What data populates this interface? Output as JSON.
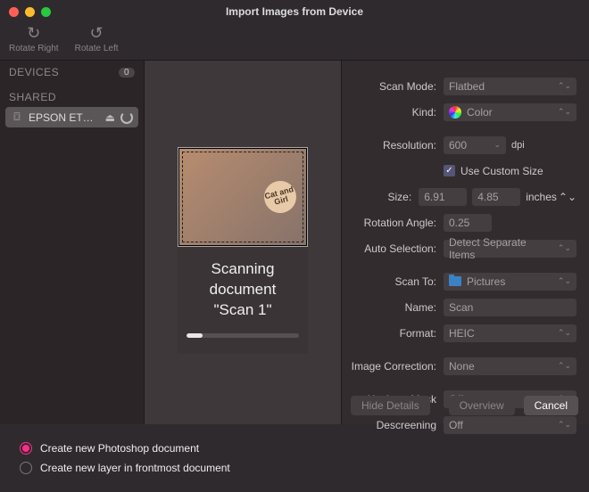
{
  "window": {
    "title": "Import Images from Device"
  },
  "toolbar": {
    "rotate_right": "Rotate Right",
    "rotate_left": "Rotate Left"
  },
  "sidebar": {
    "devices_header": "DEVICES",
    "devices_count": "0",
    "shared_header": "SHARED",
    "device_name": "EPSON ET…"
  },
  "scan": {
    "line1": "Scanning",
    "line2": "document",
    "line3": "\"Scan 1\"",
    "badge": "Cat and Girl"
  },
  "settings": {
    "scan_mode": {
      "label": "Scan Mode:",
      "value": "Flatbed"
    },
    "kind": {
      "label": "Kind:",
      "value": "Color"
    },
    "resolution": {
      "label": "Resolution:",
      "value": "600",
      "unit": "dpi"
    },
    "use_custom_size": "Use Custom Size",
    "size": {
      "label": "Size:",
      "w": "6.91",
      "h": "4.85",
      "unit": "inches"
    },
    "rotation": {
      "label": "Rotation Angle:",
      "value": "0.25"
    },
    "auto_selection": {
      "label": "Auto Selection:",
      "value": "Detect Separate Items"
    },
    "scan_to": {
      "label": "Scan To:",
      "value": "Pictures"
    },
    "name": {
      "label": "Name:",
      "value": "Scan"
    },
    "format": {
      "label": "Format:",
      "value": "HEIC"
    },
    "image_correction": {
      "label": "Image Correction:",
      "value": "None"
    },
    "unsharp": {
      "label": "Unsharp Mask",
      "value": "Off"
    },
    "descreening": {
      "label": "Descreening",
      "value": "Off"
    }
  },
  "buttons": {
    "hide_details": "Hide Details",
    "overview": "Overview",
    "cancel": "Cancel"
  },
  "footer": {
    "opt1": "Create new Photoshop document",
    "opt2": "Create new layer in frontmost document"
  }
}
